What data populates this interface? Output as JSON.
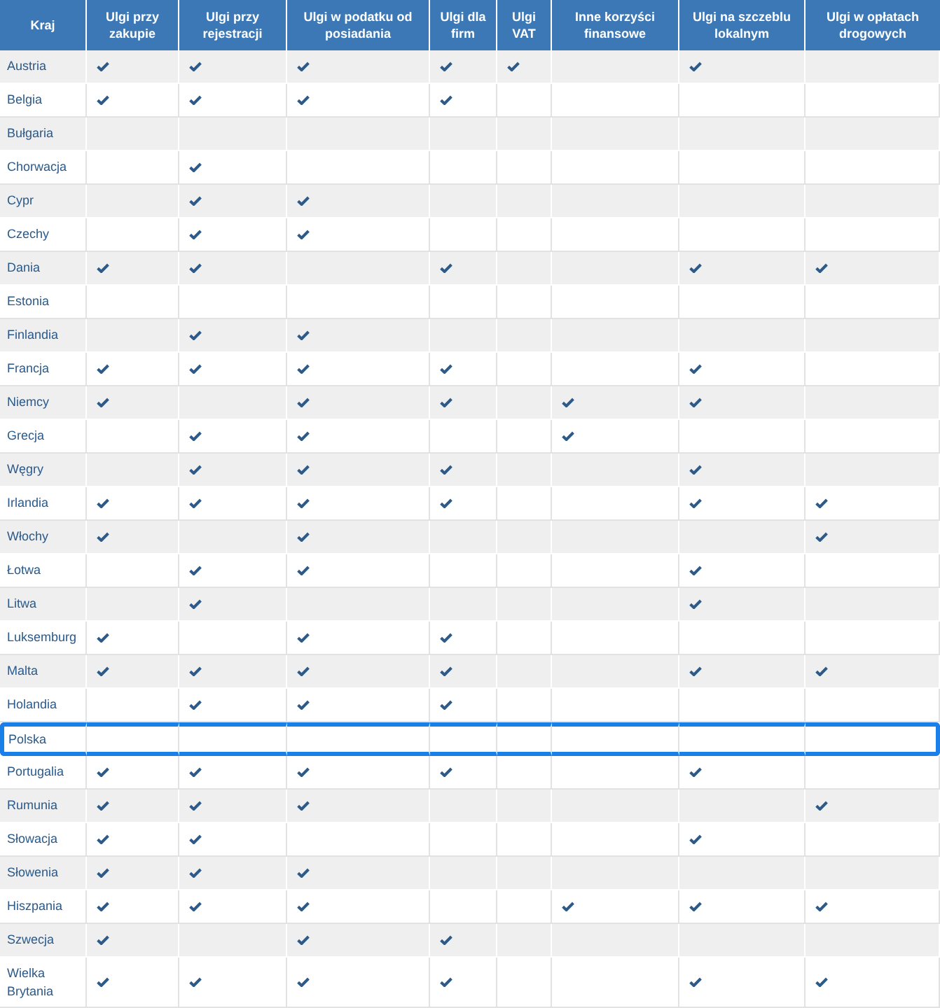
{
  "table": {
    "columns": [
      "Kraj",
      "Ulgi przy zakupie",
      "Ulgi przy rejestracji",
      "Ulgi w podatku od posiadania",
      "Ulgi dla firm",
      "Ulgi VAT",
      "Inne korzyści finansowe",
      "Ulgi na szczeblu lokalnym",
      "Ulgi w opłatach drogowych"
    ],
    "rows": [
      {
        "country": "Austria",
        "selected": false,
        "checks": [
          true,
          true,
          true,
          true,
          true,
          false,
          true,
          false
        ]
      },
      {
        "country": "Belgia",
        "selected": false,
        "checks": [
          true,
          true,
          true,
          true,
          false,
          false,
          false,
          false
        ]
      },
      {
        "country": "Bułgaria",
        "selected": false,
        "checks": [
          false,
          false,
          false,
          false,
          false,
          false,
          false,
          false
        ]
      },
      {
        "country": "Chorwacja",
        "selected": false,
        "checks": [
          false,
          true,
          false,
          false,
          false,
          false,
          false,
          false
        ]
      },
      {
        "country": "Cypr",
        "selected": false,
        "checks": [
          false,
          true,
          true,
          false,
          false,
          false,
          false,
          false
        ]
      },
      {
        "country": "Czechy",
        "selected": false,
        "checks": [
          false,
          true,
          true,
          false,
          false,
          false,
          false,
          false
        ]
      },
      {
        "country": "Dania",
        "selected": false,
        "checks": [
          true,
          true,
          false,
          true,
          false,
          false,
          true,
          true
        ]
      },
      {
        "country": "Estonia",
        "selected": false,
        "checks": [
          false,
          false,
          false,
          false,
          false,
          false,
          false,
          false
        ]
      },
      {
        "country": "Finlandia",
        "selected": false,
        "checks": [
          false,
          true,
          true,
          false,
          false,
          false,
          false,
          false
        ]
      },
      {
        "country": "Francja",
        "selected": false,
        "checks": [
          true,
          true,
          true,
          true,
          false,
          false,
          true,
          false
        ]
      },
      {
        "country": "Niemcy",
        "selected": false,
        "checks": [
          true,
          false,
          true,
          true,
          false,
          true,
          true,
          false
        ]
      },
      {
        "country": "Grecja",
        "selected": false,
        "checks": [
          false,
          true,
          true,
          false,
          false,
          true,
          false,
          false
        ]
      },
      {
        "country": "Węgry",
        "selected": false,
        "checks": [
          false,
          true,
          true,
          true,
          false,
          false,
          true,
          false
        ]
      },
      {
        "country": "Irlandia",
        "selected": false,
        "checks": [
          true,
          true,
          true,
          true,
          false,
          false,
          true,
          true
        ]
      },
      {
        "country": "Włochy",
        "selected": false,
        "checks": [
          true,
          false,
          true,
          false,
          false,
          false,
          false,
          true
        ]
      },
      {
        "country": "Łotwa",
        "selected": false,
        "checks": [
          false,
          true,
          true,
          false,
          false,
          false,
          true,
          false
        ]
      },
      {
        "country": "Litwa",
        "selected": false,
        "checks": [
          false,
          true,
          false,
          false,
          false,
          false,
          true,
          false
        ]
      },
      {
        "country": "Luksemburg",
        "selected": false,
        "checks": [
          true,
          false,
          true,
          true,
          false,
          false,
          false,
          false
        ]
      },
      {
        "country": "Malta",
        "selected": false,
        "checks": [
          true,
          true,
          true,
          true,
          false,
          false,
          true,
          true
        ]
      },
      {
        "country": "Holandia",
        "selected": false,
        "checks": [
          false,
          true,
          true,
          true,
          false,
          false,
          false,
          false
        ]
      },
      {
        "country": "Polska",
        "selected": true,
        "checks": [
          false,
          false,
          false,
          false,
          false,
          false,
          false,
          false
        ]
      },
      {
        "country": "Portugalia",
        "selected": false,
        "checks": [
          true,
          true,
          true,
          true,
          false,
          false,
          true,
          false
        ]
      },
      {
        "country": "Rumunia",
        "selected": false,
        "checks": [
          true,
          true,
          true,
          false,
          false,
          false,
          false,
          true
        ]
      },
      {
        "country": "Słowacja",
        "selected": false,
        "checks": [
          true,
          true,
          false,
          false,
          false,
          false,
          true,
          false
        ]
      },
      {
        "country": "Słowenia",
        "selected": false,
        "checks": [
          true,
          true,
          true,
          false,
          false,
          false,
          false,
          false
        ]
      },
      {
        "country": "Hiszpania",
        "selected": false,
        "checks": [
          true,
          true,
          true,
          false,
          false,
          true,
          true,
          true
        ]
      },
      {
        "country": "Szwecja",
        "selected": false,
        "checks": [
          true,
          false,
          true,
          true,
          false,
          false,
          false,
          false
        ]
      },
      {
        "country": "Wielka Brytania",
        "selected": false,
        "checks": [
          true,
          true,
          true,
          true,
          false,
          false,
          true,
          true
        ]
      }
    ]
  }
}
